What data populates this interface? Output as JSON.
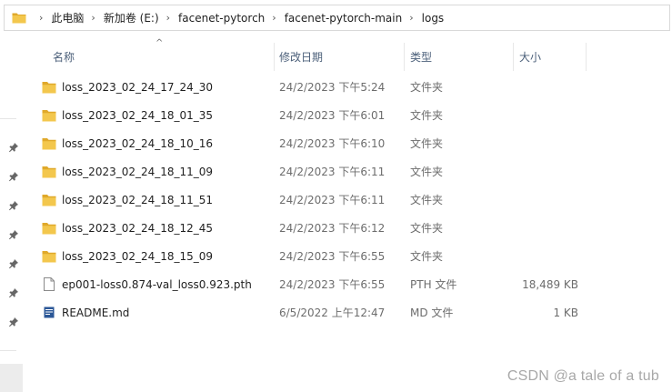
{
  "breadcrumb": [
    "此电脑",
    "新加卷 (E:)",
    "facenet-pytorch",
    "facenet-pytorch-main",
    "logs"
  ],
  "columns": {
    "name": "名称",
    "date": "修改日期",
    "type": "类型",
    "size": "大小"
  },
  "files": [
    {
      "name": "loss_2023_02_24_17_24_30",
      "date": "24/2/2023 下午5:24",
      "type": "文件夹",
      "size": "",
      "icon": "folder-icon"
    },
    {
      "name": "loss_2023_02_24_18_01_35",
      "date": "24/2/2023 下午6:01",
      "type": "文件夹",
      "size": "",
      "icon": "folder-icon"
    },
    {
      "name": "loss_2023_02_24_18_10_16",
      "date": "24/2/2023 下午6:10",
      "type": "文件夹",
      "size": "",
      "icon": "folder-icon"
    },
    {
      "name": "loss_2023_02_24_18_11_09",
      "date": "24/2/2023 下午6:11",
      "type": "文件夹",
      "size": "",
      "icon": "folder-icon"
    },
    {
      "name": "loss_2023_02_24_18_11_51",
      "date": "24/2/2023 下午6:11",
      "type": "文件夹",
      "size": "",
      "icon": "folder-icon"
    },
    {
      "name": "loss_2023_02_24_18_12_45",
      "date": "24/2/2023 下午6:12",
      "type": "文件夹",
      "size": "",
      "icon": "folder-icon"
    },
    {
      "name": "loss_2023_02_24_18_15_09",
      "date": "24/2/2023 下午6:55",
      "type": "文件夹",
      "size": "",
      "icon": "folder-icon"
    },
    {
      "name": "ep001-loss0.874-val_loss0.923.pth",
      "date": "24/2/2023 下午6:55",
      "type": "PTH 文件",
      "size": "18,489 KB",
      "icon": "file-icon"
    },
    {
      "name": "README.md",
      "date": "6/5/2022 上午12:47",
      "type": "MD 文件",
      "size": "1 KB",
      "icon": "markdown-icon"
    }
  ],
  "watermark": "CSDN @a tale of a tub",
  "colors": {
    "folder": "#f3c74d",
    "folder_dark": "#e0a92b",
    "header_text": "#4c607a",
    "secondary_text": "#6d6d6d",
    "md_icon": "#2b5797"
  }
}
